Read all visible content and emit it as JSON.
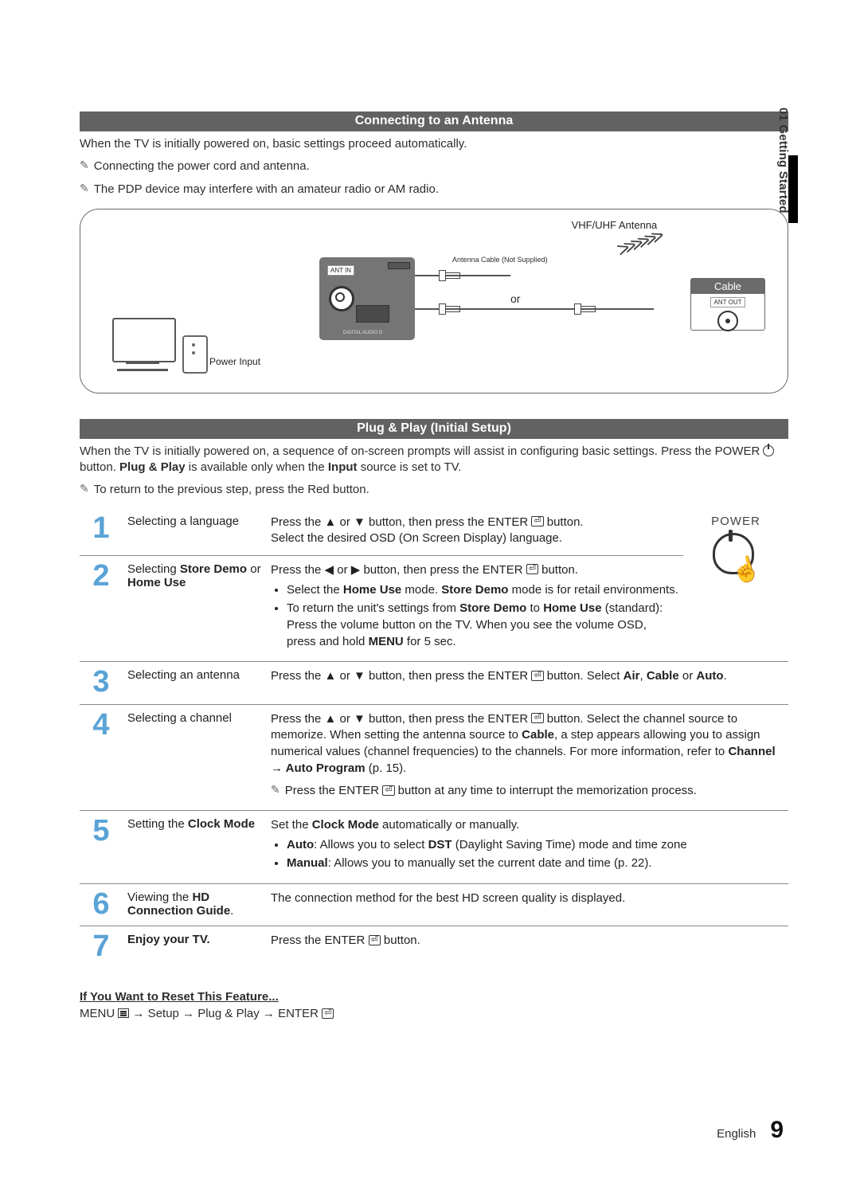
{
  "side_tab": "01  Getting Started",
  "sections": {
    "antenna": {
      "heading": "Connecting to an Antenna",
      "intro": "When the TV is initially powered on, basic settings proceed automatically.",
      "notes": [
        "Connecting the power cord and antenna.",
        "The PDP device may interfere with an amateur radio or AM radio."
      ],
      "diagram": {
        "vhf_label": "VHF/UHF Antenna",
        "ant_cable_label": "Antenna Cable (Not Supplied)",
        "ant_in": "ANT IN",
        "digital_audio": "DIGITAL\nAUDIO O",
        "power_input": "Power Input",
        "or": "or",
        "cable_caption": "Cable",
        "ant_out": "ANT OUT"
      }
    },
    "plugplay": {
      "heading": "Plug & Play (Initial Setup)",
      "intro_a": "When the TV is initially powered on, a sequence of on-screen prompts will assist in configuring basic settings. Press the POWER ",
      "intro_b": " button. ",
      "intro_bold": "Plug & Play",
      "intro_c": " is available only when the ",
      "intro_input": "Input",
      "intro_d": " source is set to TV.",
      "return_note": "To return to the previous step, press the Red button.",
      "remote_label": "POWER",
      "steps": [
        {
          "n": "1",
          "title": "Selecting a language",
          "desc_html": "Press the ▲ or ▼ button, then press the ENTER {E} button.<br>Select the desired OSD (On Screen Display) language."
        },
        {
          "n": "2",
          "title_html": "Selecting <b>Store Demo</b> or <b>Home Use</b>",
          "desc_html": "Press the ◀ or ▶ button, then press the ENTER {E} button.<ul><li>Select the <b>Home Use</b> mode. <b>Store Demo</b> mode is for retail environments.</li><li>To return the unit's settings from <b>Store Demo</b> to <b>Home Use</b> (standard): Press the volume button on the TV. When you see the volume OSD, press and hold <b>MENU</b> for 5 sec.</li></ul>"
        },
        {
          "n": "3",
          "title": "Selecting an antenna",
          "desc_html": "Press the ▲ or ▼ button, then press the ENTER {E} button. Select <b>Air</b>, <b>Cable</b> or <b>Auto</b>."
        },
        {
          "n": "4",
          "title": "Selecting a channel",
          "desc_html": "Press the ▲ or ▼ button, then press the ENTER {E} button. Select the channel source to memorize. When setting the antenna source to <b>Cable</b>, a step appears allowing you to assign numerical values (channel frequencies) to the channels. For more information, refer to <b>Channel → Auto Program</b> (p. 15).<div class='note-row' style='margin-top:8px'><span class='note-icon'>✎</span><span>Press the ENTER {E} button at any time to interrupt the memorization process.</span></div>"
        },
        {
          "n": "5",
          "title_html": "Setting the <b>Clock Mode</b>",
          "desc_html": "Set the <b>Clock Mode</b> automatically or manually.<ul><li><b>Auto</b>: Allows you to select <b>DST</b> (Daylight Saving Time) mode and time zone</li><li><b>Manual</b>: Allows you to manually set the current date and time (p. 22).</li></ul>"
        },
        {
          "n": "6",
          "title_html": "Viewing the <b>HD Connection Guide</b>.",
          "desc_html": "The connection method for the best HD screen quality is displayed."
        },
        {
          "n": "7",
          "title_html": "<b>Enjoy your TV.</b>",
          "desc_html": "Press the ENTER {E} button."
        }
      ]
    },
    "reset": {
      "heading": "If You Want to Reset This Feature...",
      "path_a": "MENU ",
      "path_b": " → Setup → Plug & Play → ENTER "
    }
  },
  "footer": {
    "lang": "English",
    "page": "9"
  },
  "glyphs": {
    "note": "✎",
    "enter": "⏎"
  }
}
